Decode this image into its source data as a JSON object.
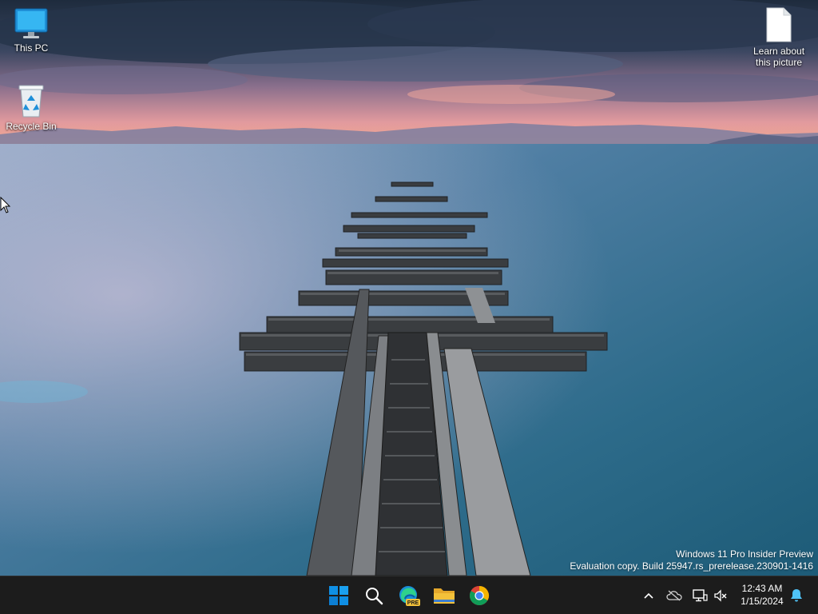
{
  "desktop": {
    "icons": [
      {
        "label": "This PC"
      },
      {
        "label": "Recycle Bin"
      },
      {
        "label_line1": "Learn about",
        "label_line2": "this picture"
      }
    ],
    "watermark": {
      "line1": "Windows 11 Pro Insider Preview",
      "line2": "Evaluation copy. Build 25947.rs_prerelease.230901-1416"
    }
  },
  "taskbar": {
    "apps": [
      "start-icon",
      "search-icon",
      "edge-pre-icon",
      "file-explorer-icon",
      "chrome-icon"
    ],
    "edge_badge": "PRE",
    "tray": {
      "icons": [
        "chevron-up-icon",
        "onedrive-icon",
        "network-icon",
        "volume-muted-icon",
        "bell-icon"
      ],
      "time": "12:43 AM",
      "date": "1/15/2024"
    }
  },
  "colors": {
    "taskbar_bg": "#1c1c1c",
    "windows_blue": "#0f8fe5",
    "folder_yellow": "#f3c13a"
  }
}
